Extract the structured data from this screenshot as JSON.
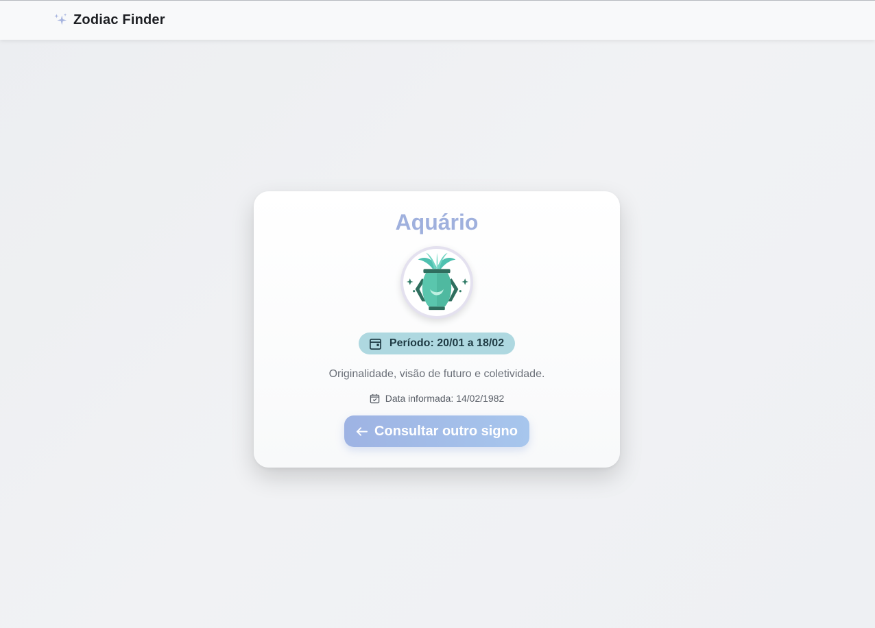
{
  "navbar": {
    "brand_icon": "sparkles-icon",
    "brand": "Zodiac Finder"
  },
  "result": {
    "sign_name": "Aquário",
    "sign_image": "aquarius-vase-illustration",
    "period_icon": "calendar-icon",
    "period": "Período: 20/01 a 18/02",
    "description": "Originalidade, visão de futuro e coletividade.",
    "date_icon": "calendar-check-icon",
    "date_info": "Data informada: 14/02/1982",
    "back_icon": "arrow-left-icon",
    "back_button": "Consultar outro signo"
  },
  "colors": {
    "accent": "#9fb0dd",
    "badge": "#aed8e0",
    "button_start": "#9eb3e3",
    "button_end": "#a7c6ed",
    "vase": "#4fb9a0"
  }
}
